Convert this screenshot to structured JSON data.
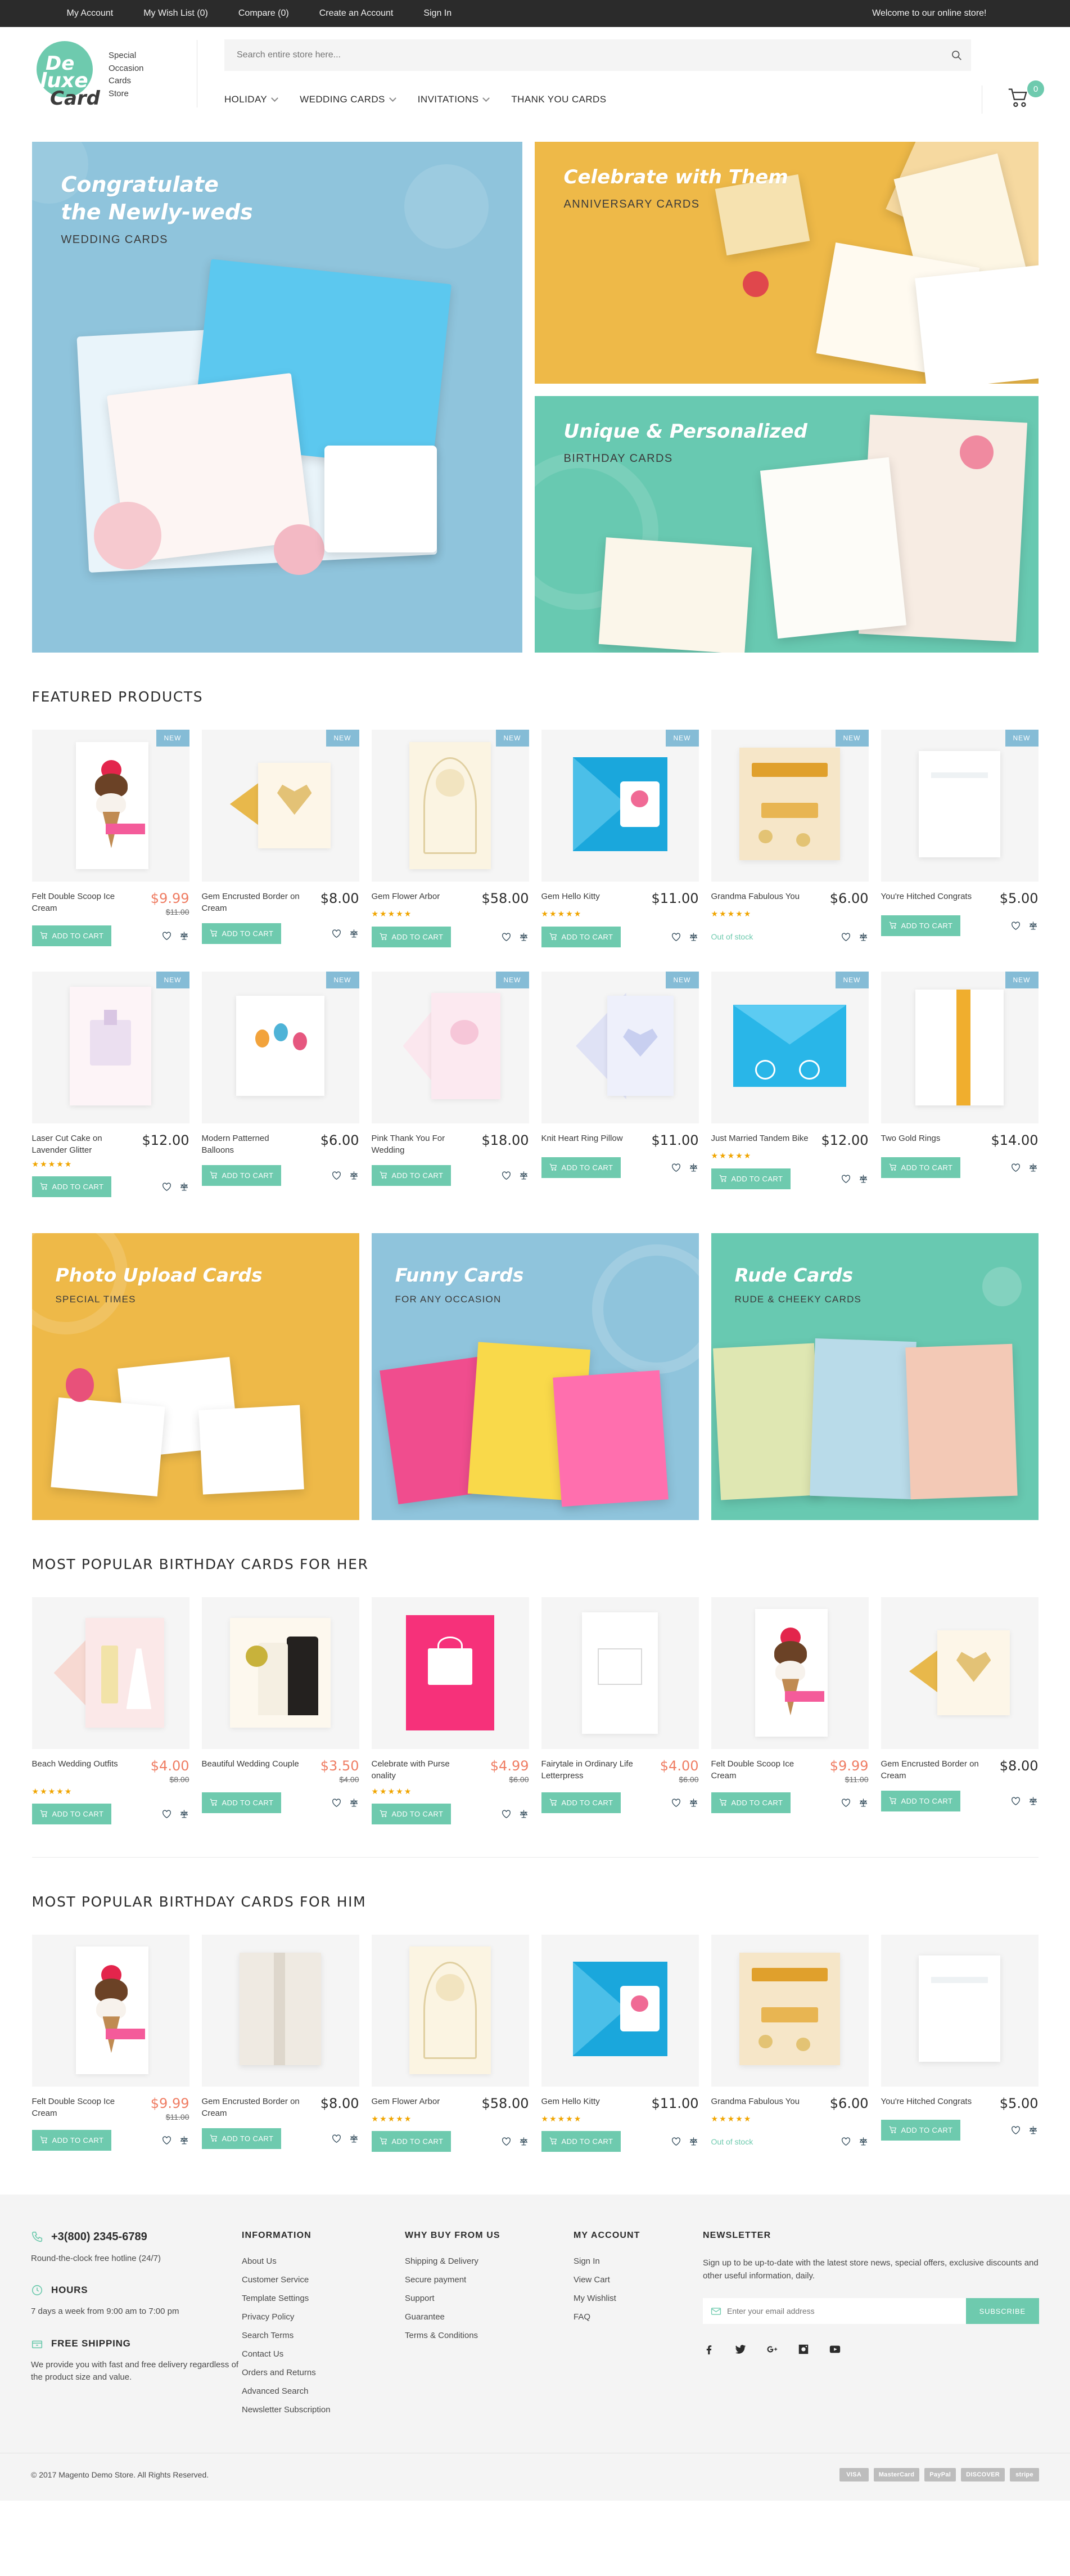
{
  "topbar": {
    "links": [
      "My Account",
      "My Wish List (0)",
      "Compare (0)",
      "Create an Account",
      "Sign In"
    ],
    "welcome": "Welcome to our online store!"
  },
  "header": {
    "logo": {
      "de": "De",
      "luxe": "luxe",
      "card": "Card"
    },
    "tagline": "Special\nOccasion\nCards\nStore",
    "search_placeholder": "Search entire store here...",
    "search_icon": "search-icon",
    "cart_icon": "cart-icon",
    "cart_count": "0",
    "nav": [
      {
        "label": "HOLIDAY",
        "caret": true
      },
      {
        "label": "WEDDING CARDS",
        "caret": true
      },
      {
        "label": "INVITATIONS",
        "caret": true
      },
      {
        "label": "THANK YOU CARDS",
        "caret": false
      }
    ]
  },
  "hero": {
    "wedding": {
      "title": "Congratulate\nthe Newly-weds",
      "sub": "WEDDING CARDS",
      "color": "#8fc4dc"
    },
    "anniversary": {
      "title": "Celebrate with Them",
      "sub": "ANNIVERSARY CARDS",
      "color": "#eeb948"
    },
    "birthday": {
      "title": "Unique & Personalized",
      "sub": "BIRTHDAY CARDS",
      "color": "#68c9b1"
    }
  },
  "sections": {
    "featured": "FEATURED PRODUCTS",
    "her": "MOST POPULAR BIRTHDAY CARDS FOR HER",
    "him": "MOST POPULAR BIRTHDAY CARDS FOR HIM"
  },
  "labels": {
    "add_to_cart": "ADD TO CART",
    "out_of_stock": "Out of stock",
    "new_badge": "NEW",
    "wishlist_icon": "heart-icon",
    "compare_icon": "compare-scales-icon",
    "cart_glyph_icon": "cart-icon"
  },
  "colors": {
    "accent": "#6ecaae",
    "sale": "#ef7d63",
    "badge": "#85bcd6",
    "star": "#f0a500",
    "dark": "#2b2b2b"
  },
  "featured_products": [
    {
      "name": "Felt Double Scoop Ice Cream",
      "price": "$9.99",
      "old_price": "$11.00",
      "sale": true,
      "new": true,
      "stars": 0,
      "in_stock": true,
      "art": "icecream"
    },
    {
      "name": "Gem Encrusted Border on Cream",
      "price": "$8.00",
      "old_price": "",
      "sale": false,
      "new": true,
      "stars": 0,
      "in_stock": true,
      "art": "gemheart"
    },
    {
      "name": "Gem Flower Arbor",
      "price": "$58.00",
      "old_price": "",
      "sale": false,
      "new": true,
      "stars": 4.5,
      "in_stock": true,
      "art": "floral"
    },
    {
      "name": "Gem Hello Kitty",
      "price": "$11.00",
      "old_price": "",
      "sale": false,
      "new": true,
      "stars": 4.5,
      "in_stock": true,
      "art": "kitty"
    },
    {
      "name": "Grandma Fabulous You",
      "price": "$6.00",
      "old_price": "",
      "sale": false,
      "new": true,
      "stars": 4.5,
      "in_stock": false,
      "art": "grandma"
    },
    {
      "name": "You're Hitched Congrats",
      "price": "$5.00",
      "old_price": "",
      "sale": false,
      "new": true,
      "stars": 0,
      "in_stock": true,
      "art": "plain"
    }
  ],
  "featured_products_row2": [
    {
      "name": "Laser Cut Cake on Lavender Glitter",
      "price": "$12.00",
      "old_price": "",
      "sale": false,
      "new": true,
      "stars": 4.5,
      "in_stock": true,
      "art": "cake"
    },
    {
      "name": "Modern Patterned Balloons",
      "price": "$6.00",
      "old_price": "",
      "sale": false,
      "new": true,
      "stars": 0,
      "in_stock": true,
      "art": "balloons"
    },
    {
      "name": "Pink Thank You For Wedding",
      "price": "$18.00",
      "old_price": "",
      "sale": false,
      "new": true,
      "stars": 0,
      "in_stock": true,
      "art": "pinkthanks"
    },
    {
      "name": "Knit Heart Ring Pillow",
      "price": "$11.00",
      "old_price": "",
      "sale": false,
      "new": true,
      "stars": 0,
      "in_stock": true,
      "art": "pillow"
    },
    {
      "name": "Just Married Tandem Bike",
      "price": "$12.00",
      "old_price": "",
      "sale": false,
      "new": true,
      "stars": 4.5,
      "in_stock": true,
      "art": "bike"
    },
    {
      "name": "Two Gold Rings",
      "price": "$14.00",
      "old_price": "",
      "sale": false,
      "new": true,
      "stars": 0,
      "in_stock": true,
      "art": "rings"
    }
  ],
  "promos": [
    {
      "title": "Photo Upload Cards",
      "sub": "SPECIAL TIMES",
      "color": "#eeb948"
    },
    {
      "title": "Funny Cards",
      "sub": "FOR ANY OCCASION",
      "color": "#8fc4dc"
    },
    {
      "title": "Rude Cards",
      "sub": "RUDE & CHEEKY CARDS",
      "color": "#68c9b1"
    }
  ],
  "her_products": [
    {
      "name": "Beach Wedding Outfits",
      "price": "$4.00",
      "old_price": "$8.00",
      "sale": true,
      "new": false,
      "stars": 4.5,
      "in_stock": true,
      "art": "beachwed"
    },
    {
      "name": "Beautiful Wedding Couple",
      "price": "$3.50",
      "old_price": "$4.00",
      "sale": true,
      "new": false,
      "stars": 0,
      "in_stock": true,
      "art": "couple"
    },
    {
      "name": "Celebrate with Purse onality",
      "price": "$4.99",
      "old_price": "$6.00",
      "sale": true,
      "new": false,
      "stars": 4.5,
      "in_stock": true,
      "art": "purse"
    },
    {
      "name": "Fairytale in Ordinary Life Letterpress",
      "price": "$4.00",
      "old_price": "$6.00",
      "sale": true,
      "new": false,
      "stars": 0,
      "in_stock": true,
      "art": "letterpress"
    },
    {
      "name": "Felt Double Scoop Ice Cream",
      "price": "$9.99",
      "old_price": "$11.00",
      "sale": true,
      "new": false,
      "stars": 0,
      "in_stock": true,
      "art": "icecream"
    },
    {
      "name": "Gem Encrusted Border on Cream",
      "price": "$8.00",
      "old_price": "",
      "sale": false,
      "new": false,
      "stars": 0,
      "in_stock": true,
      "art": "gemheart"
    }
  ],
  "him_products": [
    {
      "name": "Felt Double Scoop Ice Cream",
      "price": "$9.99",
      "old_price": "$11.00",
      "sale": true,
      "new": false,
      "stars": 0,
      "in_stock": true,
      "art": "icecream"
    },
    {
      "name": "Gem Encrusted Border on Cream",
      "price": "$8.00",
      "old_price": "",
      "sale": false,
      "new": false,
      "stars": 0,
      "in_stock": true,
      "art": "gembook"
    },
    {
      "name": "Gem Flower Arbor",
      "price": "$58.00",
      "old_price": "",
      "sale": false,
      "new": false,
      "stars": 4.5,
      "in_stock": true,
      "art": "floral"
    },
    {
      "name": "Gem Hello Kitty",
      "price": "$11.00",
      "old_price": "",
      "sale": false,
      "new": false,
      "stars": 4.5,
      "in_stock": true,
      "art": "kitty"
    },
    {
      "name": "Grandma Fabulous You",
      "price": "$6.00",
      "old_price": "",
      "sale": false,
      "new": false,
      "stars": 4.5,
      "in_stock": false,
      "art": "grandma"
    },
    {
      "name": "You're Hitched Congrats",
      "price": "$5.00",
      "old_price": "",
      "sale": false,
      "new": false,
      "stars": 0,
      "in_stock": true,
      "art": "plain"
    }
  ],
  "footer": {
    "phone": "+3(800) 2345-6789",
    "phone_icon": "phone-icon",
    "phone_note": "Round-the-clock free hotline (24/7)",
    "hours_title": "HOURS",
    "hours_icon": "clock-icon",
    "hours_note": "7 days a week from 9:00 am to 7:00 pm",
    "shipping_title": "FREE SHIPPING",
    "shipping_icon": "box-icon",
    "shipping_note": "We provide you with fast and free delivery regardless of the product size and value.",
    "information": {
      "title": "INFORMATION",
      "links": [
        "About Us",
        "Customer Service",
        "Template Settings",
        "Privacy Policy",
        "Search Terms",
        "Contact Us",
        "Orders and Returns",
        "Advanced Search",
        "Newsletter Subscription"
      ]
    },
    "why_buy": {
      "title": "WHY BUY FROM US",
      "links": [
        "Shipping & Delivery",
        "Secure payment",
        "Support",
        "Guarantee",
        "Terms & Conditions"
      ]
    },
    "my_account": {
      "title": "MY ACCOUNT",
      "links": [
        "Sign In",
        "View Cart",
        "My Wishlist",
        "FAQ"
      ]
    },
    "newsletter": {
      "title": "NEWSLETTER",
      "text": "Sign up to be up-to-date with the latest store news, special offers, exclusive discounts and other useful information, daily.",
      "placeholder": "Enter your email address",
      "button": "SUBSCRIBE",
      "email_icon": "envelope-icon"
    },
    "social": [
      "facebook-icon",
      "twitter-icon",
      "google-plus-icon",
      "instagram-icon",
      "youtube-icon"
    ],
    "copyright": "© 2017 Magento Demo Store. All Rights Reserved.",
    "payments": [
      "VISA",
      "MasterCard",
      "PayPal",
      "DISCOVER",
      "stripe"
    ]
  }
}
